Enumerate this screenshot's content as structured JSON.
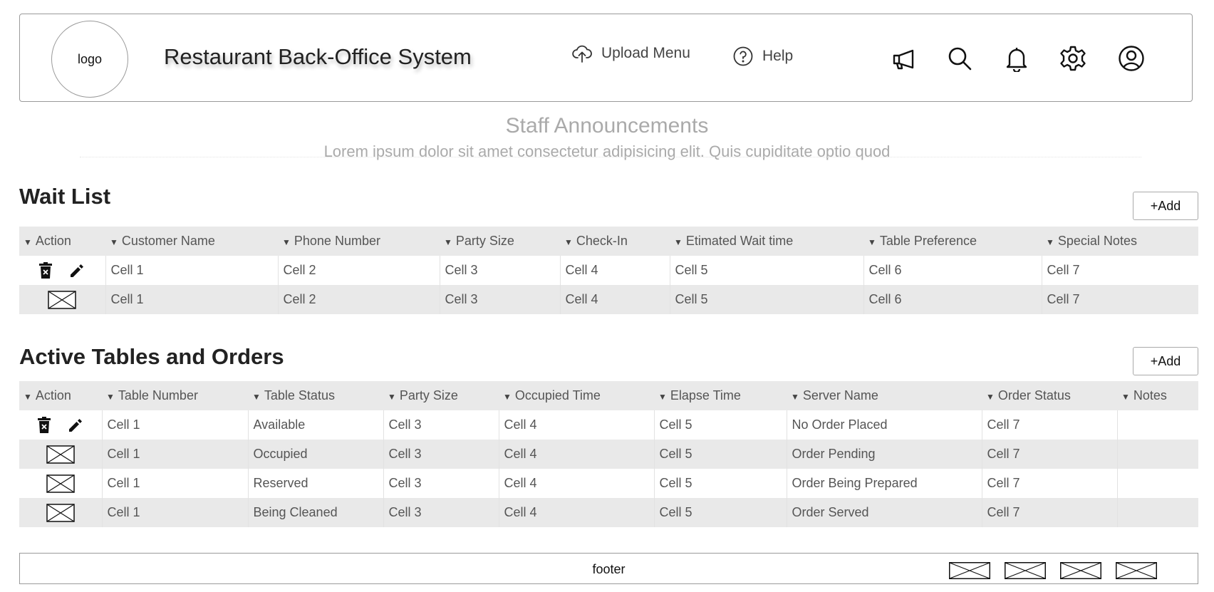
{
  "header": {
    "logo_text": "logo",
    "title": "Restaurant Back-Office System",
    "nav": [
      {
        "label": "Upload Menu",
        "icon": "cloud-upload-icon"
      },
      {
        "label": "Help",
        "icon": "help-circle-icon"
      }
    ],
    "icons": [
      "megaphone-icon",
      "search-icon",
      "bell-icon",
      "gear-icon",
      "user-avatar-icon"
    ]
  },
  "announcements": {
    "title": "Staff Announcements",
    "body": "Lorem ipsum dolor sit amet consectetur adipisicing elit. Quis cupiditate optio quod"
  },
  "wait_list": {
    "title": "Wait List",
    "add_label": "+Add",
    "columns": [
      "Action",
      "Customer Name",
      "Phone Number",
      "Party Size",
      "Check-In",
      "Etimated Wait time",
      "Table Preference",
      "Special Notes"
    ],
    "rows": [
      {
        "action": "edit-delete",
        "cells": [
          "Cell 1",
          "Cell 2",
          "Cell 3",
          "Cell 4",
          "Cell 5",
          "Cell 6",
          "Cell 7"
        ]
      },
      {
        "action": "placeholder",
        "cells": [
          "Cell 1",
          "Cell 2",
          "Cell 3",
          "Cell 4",
          "Cell 5",
          "Cell 6",
          "Cell 7"
        ]
      }
    ]
  },
  "active_tables": {
    "title": "Active Tables and Orders",
    "add_label": "+Add",
    "columns": [
      "Action",
      "Table Number",
      "Table Status",
      "Party Size",
      "Occupied Time",
      "Elapse Time",
      "Server Name",
      "Order Status",
      "Notes"
    ],
    "rows": [
      {
        "action": "edit-delete",
        "cells": [
          "Cell 1",
          "Available",
          "Cell 3",
          "Cell 4",
          "Cell 5",
          "No Order Placed",
          "Cell 7",
          ""
        ]
      },
      {
        "action": "placeholder",
        "cells": [
          "Cell 1",
          "Occupied",
          "Cell 3",
          "Cell 4",
          "Cell 5",
          "Order Pending",
          "Cell 7",
          ""
        ]
      },
      {
        "action": "placeholder",
        "cells": [
          "Cell 1",
          "Reserved",
          "Cell 3",
          "Cell 4",
          "Cell 5",
          "Order Being Prepared",
          "Cell 7",
          ""
        ]
      },
      {
        "action": "placeholder",
        "cells": [
          "Cell 1",
          "Being Cleaned",
          "Cell 3",
          "Cell 4",
          "Cell 5",
          "Order Served",
          "Cell 7",
          ""
        ]
      }
    ]
  },
  "footer": {
    "text": "footer",
    "images": [
      "image-placeholder-icon",
      "image-placeholder-icon",
      "image-placeholder-icon",
      "image-placeholder-icon"
    ]
  }
}
